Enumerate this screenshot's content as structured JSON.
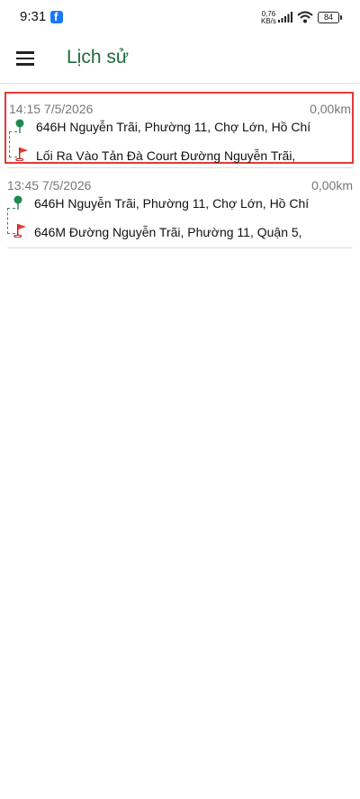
{
  "status": {
    "time": "9:31",
    "net_speed_value": "0,76",
    "net_speed_unit": "KB/s",
    "battery": "84"
  },
  "header": {
    "title": "Lịch sử"
  },
  "trips": [
    {
      "time": "14:15 7/5/2026",
      "distance": "0,00km",
      "origin": "646H Nguyễn Trãi, Phường 11, Chợ Lớn, Hồ Chí",
      "destination": "Lối Ra Vào Tản Đà Court Đường Nguyễn Trãi,"
    },
    {
      "time": "13:45 7/5/2026",
      "distance": "0,00km",
      "origin": "646H Nguyễn Trãi, Phường 11, Chợ Lớn, Hồ Chí",
      "destination": "646M Đường Nguyễn Trãi, Phường 11, Quận 5,"
    }
  ],
  "colors": {
    "brand_green": "#1e6b3a",
    "selected_border": "#e53935"
  }
}
